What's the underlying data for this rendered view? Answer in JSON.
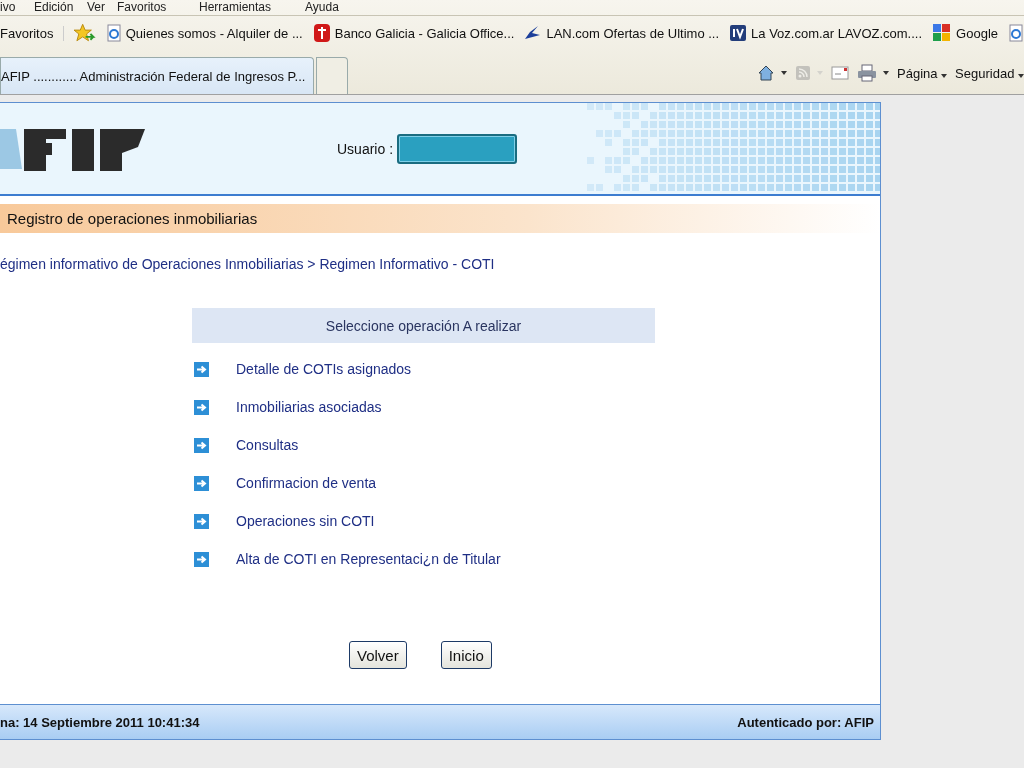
{
  "menu_bar": {
    "items": [
      "ivo",
      "Edición",
      "Ver",
      "Favoritos",
      "Herramientas",
      "Ayuda"
    ]
  },
  "favorites_bar": {
    "button": "Favoritos",
    "links": [
      {
        "kind": "page",
        "title": "Quienes somos - Alquiler de ..."
      },
      {
        "kind": "bank",
        "title": "Banco Galicia - Galicia Office..."
      },
      {
        "kind": "plane",
        "title": "LAN.com Ofertas de Ultimo ..."
      },
      {
        "kind": "badge",
        "title": "La Voz.com.ar  LAVOZ.com...."
      },
      {
        "kind": "google",
        "title": "Google"
      },
      {
        "kind": "page"
      }
    ]
  },
  "tabs": [
    {
      "title": "AFIP ............ Administración Federal de Ingresos P...",
      "selected": true
    },
    {
      "selected": false
    }
  ],
  "command_bar": {
    "tools": [
      {
        "kind": "home",
        "dropdown": true,
        "disabled": false
      },
      {
        "kind": "feed",
        "dropdown": true,
        "disabled": true
      },
      {
        "kind": "mail",
        "dropdown": false,
        "disabled": false
      },
      {
        "kind": "print",
        "dropdown": true,
        "disabled": false
      }
    ],
    "menus": [
      "Página",
      "Seguridad"
    ]
  },
  "page": {
    "header": {
      "user_label": "Usuario",
      "user_separator": ":"
    },
    "section_title": "Registro de operaciones inmobiliarias",
    "breadcrumb": "égimen informativo de Operaciones Inmobiliarias > Regimen Informativo - COTI",
    "operations": {
      "title": "Seleccione operación A realizar",
      "items": [
        "Detalle de COTIs asignados",
        "Inmobiliarias asociadas",
        "Consultas",
        "Confirmacion de venta",
        "Operaciones sin COTI",
        "Alta de COTI en Representaci¿n de Titular"
      ]
    },
    "buttons": [
      "Volver",
      "Inicio"
    ],
    "footer": {
      "date": "na: 14 Septiembre 2011 10:41:34",
      "auth": "Autenticado por: AFIP"
    }
  }
}
